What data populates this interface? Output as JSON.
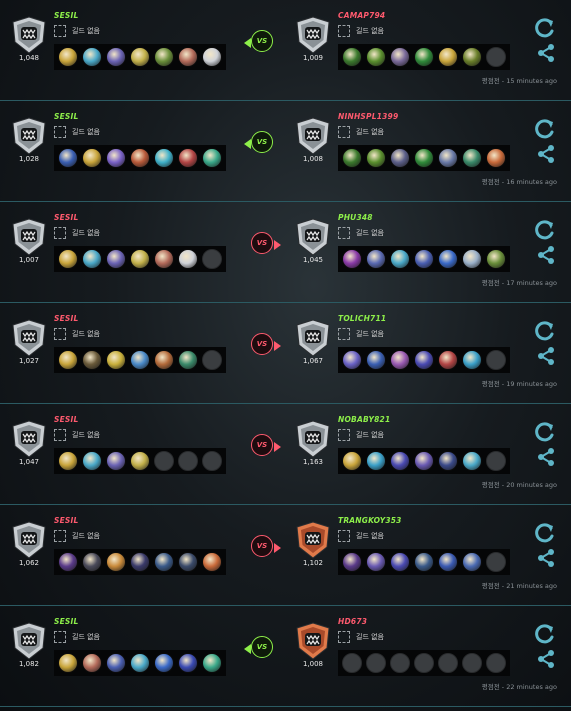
{
  "colors": {
    "win": "#8ef04a",
    "lose": "#ff5a6e",
    "accent": "#5fb6c8",
    "divider": "#2b5a62"
  },
  "vs_label": "VS",
  "guild_label": "길드 없음",
  "matches": [
    {
      "left": {
        "name": "SESIL",
        "rating": "1,048",
        "result": "win",
        "tier": "silver",
        "heroes": [
          "#c9a53b",
          "#4aa9c9",
          "#6b63b5",
          "#c2b04a",
          "#6a8f3a",
          "#b36a5a",
          "#cfd2d8"
        ]
      },
      "right": {
        "name": "CAMAP794",
        "rating": "1,009",
        "result": "lose",
        "tier": "silver",
        "heroes": [
          "#3b7a2d",
          "#5a8f2e",
          "#7a6a9a",
          "#2f8a3a",
          "#c9a53b",
          "#6a7f2a",
          "empty"
        ]
      },
      "vs_result": "win",
      "time": "평점전 - 15 minutes ago"
    },
    {
      "left": {
        "name": "SESIL",
        "rating": "1,028",
        "result": "win",
        "tier": "silver",
        "heroes": [
          "#3a5fb3",
          "#c9a53b",
          "#7a62c7",
          "#b85a3a",
          "#3fb0c9",
          "#b34545",
          "#3aa98a"
        ]
      },
      "right": {
        "name": "NINHSPL1399",
        "rating": "1,008",
        "result": "lose",
        "tier": "silver",
        "heroes": [
          "#3b7a2d",
          "#5a8f2e",
          "#5c5f8a",
          "#2f8a3a",
          "#6a7aa8",
          "#3a8a6a",
          "#c96a3a"
        ]
      },
      "vs_result": "win",
      "time": "평점전 - 16 minutes ago"
    },
    {
      "left": {
        "name": "SESIL",
        "rating": "1,007",
        "result": "lose",
        "tier": "silver",
        "heroes": [
          "#c9a53b",
          "#4aa9c9",
          "#6b63b5",
          "#c2b04a",
          "#b36a5a",
          "#cfd2d8",
          "empty"
        ]
      },
      "right": {
        "name": "PHU348",
        "rating": "1,045",
        "result": "win",
        "tier": "silver",
        "heroes": [
          "#8a3aa8",
          "#5a6ab3",
          "#4aa9c9",
          "#4a5fb3",
          "#3a6ac9",
          "#9ab0c9",
          "#6a8f3a"
        ]
      },
      "vs_result": "lose",
      "time": "평점전 - 17 minutes ago"
    },
    {
      "left": {
        "name": "SESIL",
        "rating": "1,027",
        "result": "lose",
        "tier": "silver",
        "heroes": [
          "#c9a53b",
          "#6a5a3a",
          "#c9b03b",
          "#4a8ac9",
          "#b36a3a",
          "#3a8a6a",
          "empty"
        ]
      },
      "right": {
        "name": "TOLICH711",
        "rating": "1,067",
        "result": "win",
        "tier": "silver",
        "heroes": [
          "#6a62c7",
          "#3a5fb3",
          "#9a5ab3",
          "#4a4ab3",
          "#b34545",
          "#3aa0c9",
          "empty"
        ]
      },
      "vs_result": "lose",
      "time": "평점전 - 19 minutes ago"
    },
    {
      "left": {
        "name": "SESIL",
        "rating": "1,047",
        "result": "lose",
        "tier": "silver",
        "heroes": [
          "#c9a53b",
          "#4aa9c9",
          "#6b63b5",
          "#c2b04a",
          "empty",
          "empty",
          "empty"
        ]
      },
      "right": {
        "name": "NOBABY821",
        "rating": "1,163",
        "result": "win",
        "tier": "silver",
        "heroes": [
          "#c9a53b",
          "#3aa0c9",
          "#4a4ab3",
          "#6a5ab3",
          "#3a4a8a",
          "#4aa9c9",
          "empty"
        ]
      },
      "vs_result": "lose",
      "time": "평점전 - 20 minutes ago"
    },
    {
      "left": {
        "name": "SESIL",
        "rating": "1,062",
        "result": "lose",
        "tier": "silver",
        "heroes": [
          "#5a3a8a",
          "#4a4a5a",
          "#c98a3a",
          "#3a3a6a",
          "#3a5a8a",
          "#3a4a6a",
          "#c96a3a"
        ]
      },
      "right": {
        "name": "TRANGKOY353",
        "rating": "1,102",
        "result": "win",
        "tier": "bronze",
        "heroes": [
          "#5a3a8a",
          "#6a5ab3",
          "#4a4ab3",
          "#3a5a8a",
          "#3a5ab3",
          "#4a6ab3",
          "empty"
        ]
      },
      "vs_result": "lose",
      "time": "평점전 - 21 minutes ago"
    },
    {
      "left": {
        "name": "SESIL",
        "rating": "1,082",
        "result": "win",
        "tier": "silver",
        "heroes": [
          "#c9a53b",
          "#b36a5a",
          "#4a5fb3",
          "#4aa9c9",
          "#3a6ac9",
          "#3a4ab3",
          "#3aa98a"
        ]
      },
      "right": {
        "name": "HD673",
        "rating": "1,008",
        "result": "lose",
        "tier": "bronze",
        "heroes": [
          "empty",
          "empty",
          "empty",
          "empty",
          "empty",
          "empty",
          "empty"
        ]
      },
      "vs_result": "win",
      "time": "평점전 - 22 minutes ago"
    }
  ],
  "icons": {
    "tier_badge": "shield-badge-icon",
    "replay": "refresh-icon",
    "share": "share-icon"
  }
}
